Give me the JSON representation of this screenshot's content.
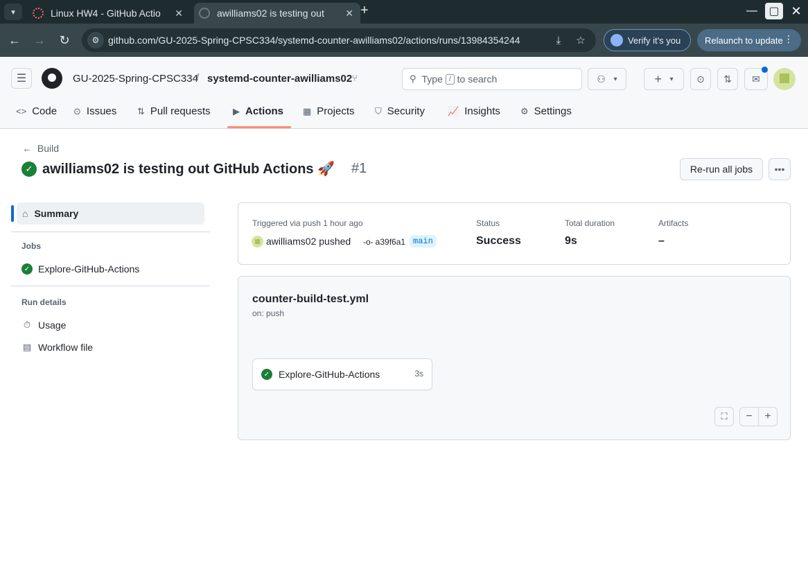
{
  "browser": {
    "tabs": [
      {
        "title": "Linux HW4 - GitHub Actio",
        "active": false
      },
      {
        "title": "awilliams02 is testing out",
        "active": true
      }
    ],
    "url": "github.com/GU-2025-Spring-CPSC334/systemd-counter-awilliams02/actions/runs/13984354244",
    "verify_label": "Verify it's you",
    "relaunch_label": "Relaunch to update"
  },
  "header": {
    "owner": "GU-2025-Spring-CPSC334",
    "separator": "/",
    "repo": "systemd-counter-awilliams02",
    "search_prefix": "Type",
    "search_key": "/",
    "search_suffix": "to search"
  },
  "repo_nav": [
    {
      "label": "Code",
      "icon": "code-icon"
    },
    {
      "label": "Issues",
      "icon": "issue-icon"
    },
    {
      "label": "Pull requests",
      "icon": "pull-request-icon"
    },
    {
      "label": "Actions",
      "icon": "play-icon",
      "active": true
    },
    {
      "label": "Projects",
      "icon": "table-icon"
    },
    {
      "label": "Security",
      "icon": "shield-icon"
    },
    {
      "label": "Insights",
      "icon": "graph-icon"
    },
    {
      "label": "Settings",
      "icon": "gear-icon"
    }
  ],
  "run": {
    "back_label": "Build",
    "title": "awilliams02 is testing out GitHub Actions 🚀",
    "number": "#1",
    "rerun_label": "Re-run all jobs"
  },
  "sidebar": {
    "summary_label": "Summary",
    "jobs_heading": "Jobs",
    "job_label": "Explore-GitHub-Actions",
    "run_details_heading": "Run details",
    "usage_label": "Usage",
    "workflow_file_label": "Workflow file"
  },
  "summary": {
    "trigger_label": "Triggered via push 1 hour ago",
    "actor": "awilliams02 pushed",
    "commit": "a39f6a1",
    "branch": "main",
    "status_label": "Status",
    "status_value": "Success",
    "duration_label": "Total duration",
    "duration_value": "9s",
    "artifacts_label": "Artifacts",
    "artifacts_value": "–"
  },
  "workflow": {
    "file": "counter-build-test.yml",
    "trigger": "on: push",
    "job_name": "Explore-GitHub-Actions",
    "job_duration": "3s"
  },
  "colors": {
    "success": "#1a7f37",
    "accent": "#0969da",
    "active_tab_underline": "#fd8c73"
  }
}
